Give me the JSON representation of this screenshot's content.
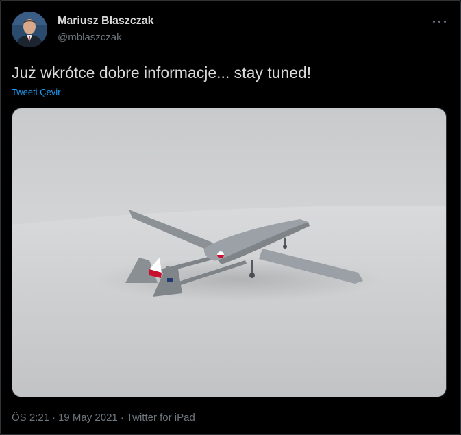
{
  "author": {
    "name": "Mariusz Błaszczak",
    "handle": "@mblaszczak"
  },
  "tweet": {
    "text": "Już wkrótce dobre informacje... stay tuned!",
    "translate_label": "Tweeti Çevir"
  },
  "meta": {
    "time": "ÖS 2:21",
    "date": "19 May 2021",
    "separator": "·",
    "source": "Twitter for iPad"
  },
  "icons": {
    "more": "more-dots-icon",
    "avatar": "avatar-photo"
  },
  "colors": {
    "background": "#000000",
    "text": "#d9d9d9",
    "secondary": "#6e767d",
    "link": "#1d9bf0",
    "border": "#2f3336"
  }
}
